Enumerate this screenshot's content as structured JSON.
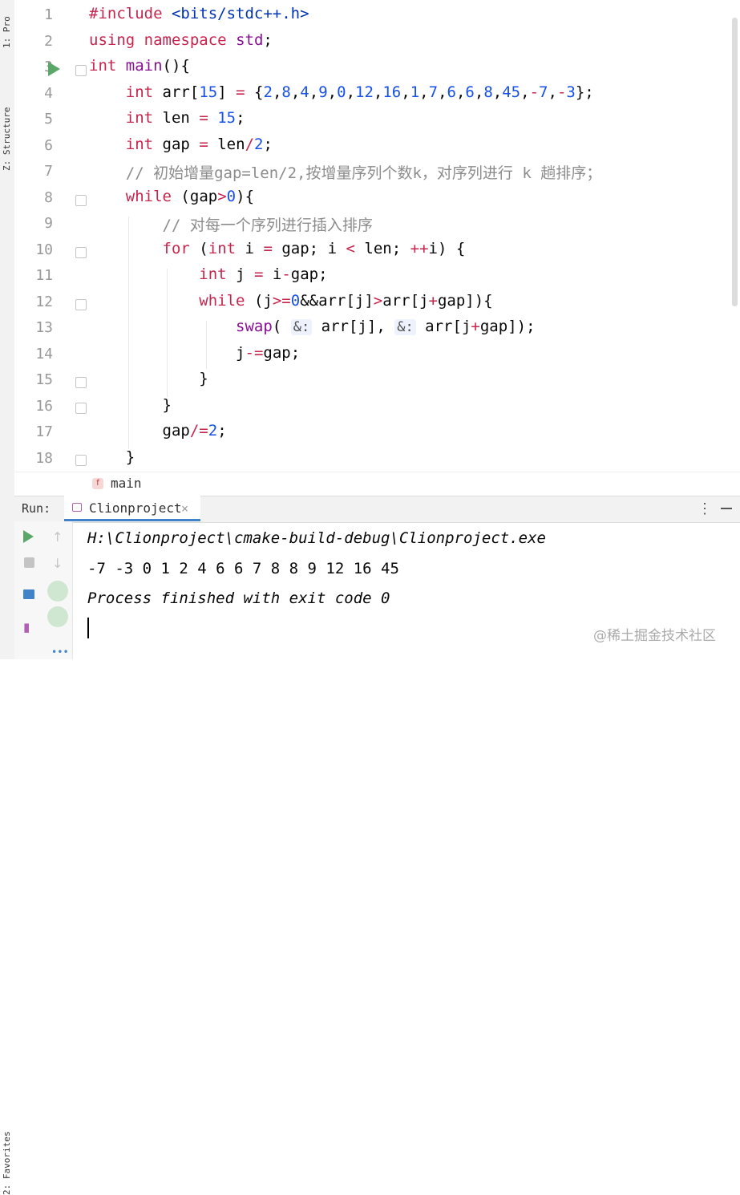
{
  "left_panel": {
    "project_tab": "1: Pro",
    "structure_tab": "Z: Structure",
    "favorites_tab": "2: Favorites"
  },
  "editor": {
    "line_numbers": [
      "1",
      "2",
      "3",
      "4",
      "5",
      "6",
      "7",
      "8",
      "9",
      "10",
      "11",
      "12",
      "13",
      "14",
      "15",
      "16",
      "17",
      "18"
    ],
    "lines": [
      {
        "t": "#include <bits/stdc++.h>"
      },
      {
        "t": "using namespace std;"
      },
      {
        "t": "int main(){"
      },
      {
        "t": "    int arr[15] = {2,8,4,9,0,12,16,1,7,6,6,8,45,-7,-3};"
      },
      {
        "t": "    int len = 15;"
      },
      {
        "t": "    int gap = len/2;"
      },
      {
        "t": "    // 初始增量gap=len/2,按增量序列个数k，对序列进行 k 趟排序；"
      },
      {
        "t": "    while (gap>0){"
      },
      {
        "t": "        // 对每一个序列进行插入排序"
      },
      {
        "t": "        for (int i = gap; i < len; ++i) {"
      },
      {
        "t": "            int j = i-gap;"
      },
      {
        "t": "            while (j>=0&&arr[j]>arr[j+gap]){"
      },
      {
        "t": "                swap( &: arr[j], &: arr[j+gap]);"
      },
      {
        "t": "                j-=gap;"
      },
      {
        "t": "            }"
      },
      {
        "t": "        }"
      },
      {
        "t": "        gap/=2;"
      },
      {
        "t": "    }"
      }
    ]
  },
  "breadcrumb": {
    "badge": "f",
    "label": "main"
  },
  "run_panel": {
    "label": "Run:",
    "tab_label": "Clionproject",
    "close_glyph": "×",
    "more_glyph": "⋮",
    "output": [
      "H:\\Clionproject\\cmake-build-debug\\Clionproject.exe",
      "-7 -3 0 1 2 4 6 6 7 8 8 9 12 16 45",
      "Process finished with exit code 0"
    ]
  },
  "watermark": "@稀土掘金技术社区",
  "colors": {
    "accent": "#4083c9",
    "run_green": "#59a869",
    "keyword": "#0033b3"
  }
}
